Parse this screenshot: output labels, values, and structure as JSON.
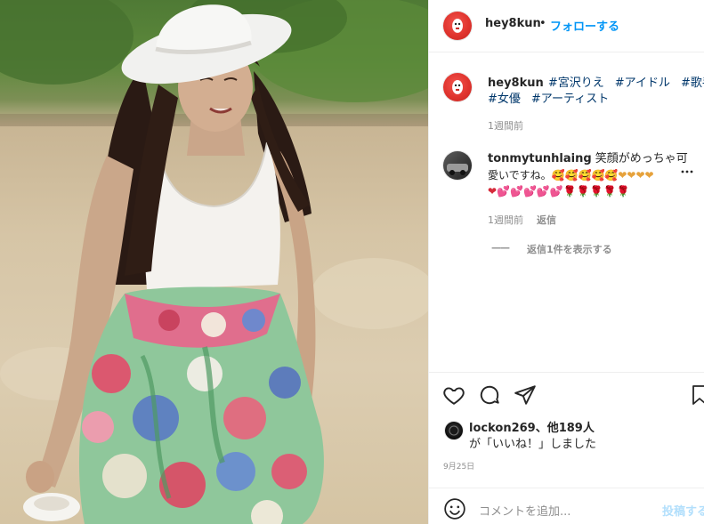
{
  "post": {
    "author": "hey8kun",
    "separator": "•",
    "follow_label": "フォローする"
  },
  "caption": {
    "author": "hey8kun",
    "hashtags_line1": [
      "#宮沢りえ",
      "#アイドル",
      "#歌手"
    ],
    "hashtags_line2": [
      "#女優",
      "#アーティスト"
    ],
    "time": "1週間前"
  },
  "comment": {
    "author": "tonmytunhlaing",
    "text_line1": "笑顔がめっちゃ可",
    "text_line2": "愛いですね。",
    "emoji_line1": "🥰🥰🥰🥰🥰❤❤❤❤",
    "emoji_line2": "❤💕💕💕💕💕🌹🌹🌹🌹🌹",
    "time": "1週間前",
    "reply_label": "返信",
    "view_replies_dash": "——",
    "view_replies_label": "返信1件を表示する"
  },
  "likes": {
    "liker": "lockon269",
    "others": "、他189人",
    "suffix": "が「いいね！」しました",
    "date": "9月25日"
  },
  "add_comment": {
    "placeholder": "コメントを追加...",
    "post_label": "投稿する"
  },
  "colors": {
    "link_blue": "#0095f6",
    "hashtag": "#00376b",
    "muted": "#8e8e8e",
    "avatar_red": "#e0342e"
  }
}
